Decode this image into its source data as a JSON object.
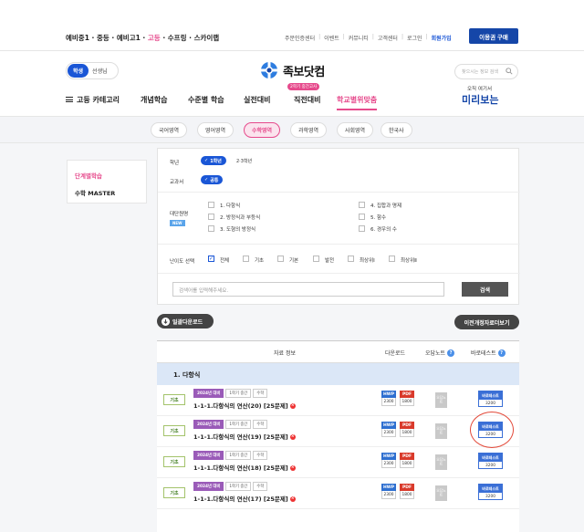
{
  "header": {
    "grades": [
      "예비중1",
      "중등",
      "예비고1",
      "고등",
      "수프링",
      "스카이랩"
    ],
    "grades_active": "고등",
    "util_links": [
      "주문인증센터",
      "이벤트",
      "커뮤니티",
      "고객센터",
      "로그인",
      "회원가입"
    ],
    "buy_button": "이용권 구매",
    "toggle": {
      "student": "학생",
      "teacher": "선생님"
    },
    "logo_text": "족보닷컴",
    "search_placeholder": "찾으시는 정보 검색"
  },
  "nav": {
    "category": "고등 카테고리",
    "items": [
      "개념학습",
      "수준별 학습",
      "실전대비",
      "직전대비",
      "학교별위맞춤"
    ],
    "badge": "2학기 중간고사",
    "preview_small": "오직 여기서",
    "preview_big": "미리보는"
  },
  "subjects": [
    "국어영역",
    "영어영역",
    "수학영역",
    "과학영역",
    "사회영역",
    "한국사"
  ],
  "active_subject": "수학영역",
  "sidebar": {
    "items": [
      "단계별학습",
      "수학 MASTER"
    ]
  },
  "filter": {
    "grade_label": "학년",
    "grade_selected": "1학년",
    "grade_other": "2·3학년",
    "textbook_label": "교과서",
    "textbook_selected": "공통",
    "unit_label": "대단원명",
    "new_badge": "NEW",
    "units_left": [
      "1. 다항식",
      "2. 방정식과 부등식",
      "3. 도형의 방정식"
    ],
    "units_right": [
      "4. 집합과 명제",
      "5. 함수",
      "6. 경우의 수"
    ],
    "level_label": "난이도 선택",
    "levels": [
      "전체",
      "기초",
      "기본",
      "발전",
      "최상위Ⅰ",
      "최상위Ⅱ"
    ],
    "keyword_placeholder": "검색어를 입력해주세요.",
    "search_button": "검색"
  },
  "actions": {
    "bulk_download": "일괄다운로드",
    "prev_curriculum": "이전개정자료더보기"
  },
  "table": {
    "headers": [
      "자료 정보",
      "다운로드",
      "오답노트",
      "바로테스트"
    ],
    "section": "1. 다항식",
    "rows": [
      {
        "level": "기초",
        "year": "2024년 대비",
        "term": "1학기 중간",
        "subject": "수학",
        "title": "1-1-1.다항식의 연산(20) [25문제]",
        "hwp": "2300",
        "pdf": "1800",
        "wrong": "오답노트",
        "test": "바로테스트",
        "test_price": "3200"
      },
      {
        "level": "기초",
        "year": "2024년 대비",
        "term": "1학기 중간",
        "subject": "수학",
        "title": "1-1-1.다항식의 연산(19) [25문제]",
        "hwp": "2300",
        "pdf": "1800",
        "wrong": "오답노트",
        "test": "바로테스트",
        "test_price": "3200"
      },
      {
        "level": "기초",
        "year": "2024년 대비",
        "term": "1학기 중간",
        "subject": "수학",
        "title": "1-1-1.다항식의 연산(18) [25문제]",
        "hwp": "2300",
        "pdf": "1800",
        "wrong": "오답노트",
        "test": "바로테스트",
        "test_price": "3200"
      },
      {
        "level": "기초",
        "year": "2024년 대비",
        "term": "1학기 중간",
        "subject": "수학",
        "title": "1-1-1.다항식의 연산(17) [25문제]",
        "hwp": "2300",
        "pdf": "1800",
        "wrong": "오답노트",
        "test": "바로테스트",
        "test_price": "3200"
      }
    ]
  },
  "colors": {
    "brand_blue": "#1546a8",
    "accent_pink": "#e64a8c",
    "annotation_red": "#e34a3a"
  }
}
